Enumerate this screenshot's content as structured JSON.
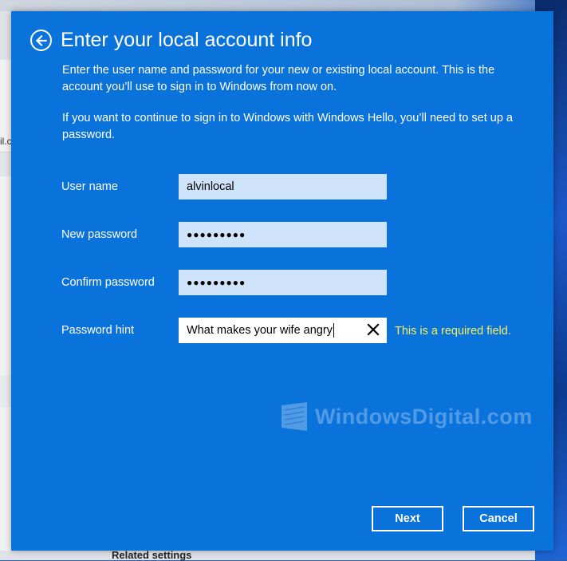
{
  "background": {
    "email_fragment": "il.c",
    "related_settings": "Related settings"
  },
  "dialog": {
    "title": "Enter your local account info",
    "description_1": "Enter the user name and password for your new or existing local account. This is the account you’ll use to sign in to Windows from now on.",
    "description_2": "If you want to continue to sign in to Windows with Windows Hello, you’ll need to set up a password.",
    "fields": {
      "username": {
        "label": "User name",
        "value": "alvinlocal"
      },
      "new_password": {
        "label": "New password",
        "value": "●●●●●●●●●"
      },
      "confirm_password": {
        "label": "Confirm password",
        "value": "●●●●●●●●●"
      },
      "password_hint": {
        "label": "Password hint",
        "value": "What makes your wife angry",
        "error": "This is a required field."
      }
    },
    "buttons": {
      "next": "Next",
      "cancel": "Cancel"
    }
  },
  "watermark": {
    "text": "WindowsDigital.com"
  },
  "colors": {
    "dialog_bg": "#0a73db",
    "field_bg": "#cfe4fa",
    "error": "#f7f05a"
  },
  "icons": {
    "back": "back-arrow-icon",
    "clear": "close-icon",
    "watermark_logo": "windows-logo-icon"
  }
}
